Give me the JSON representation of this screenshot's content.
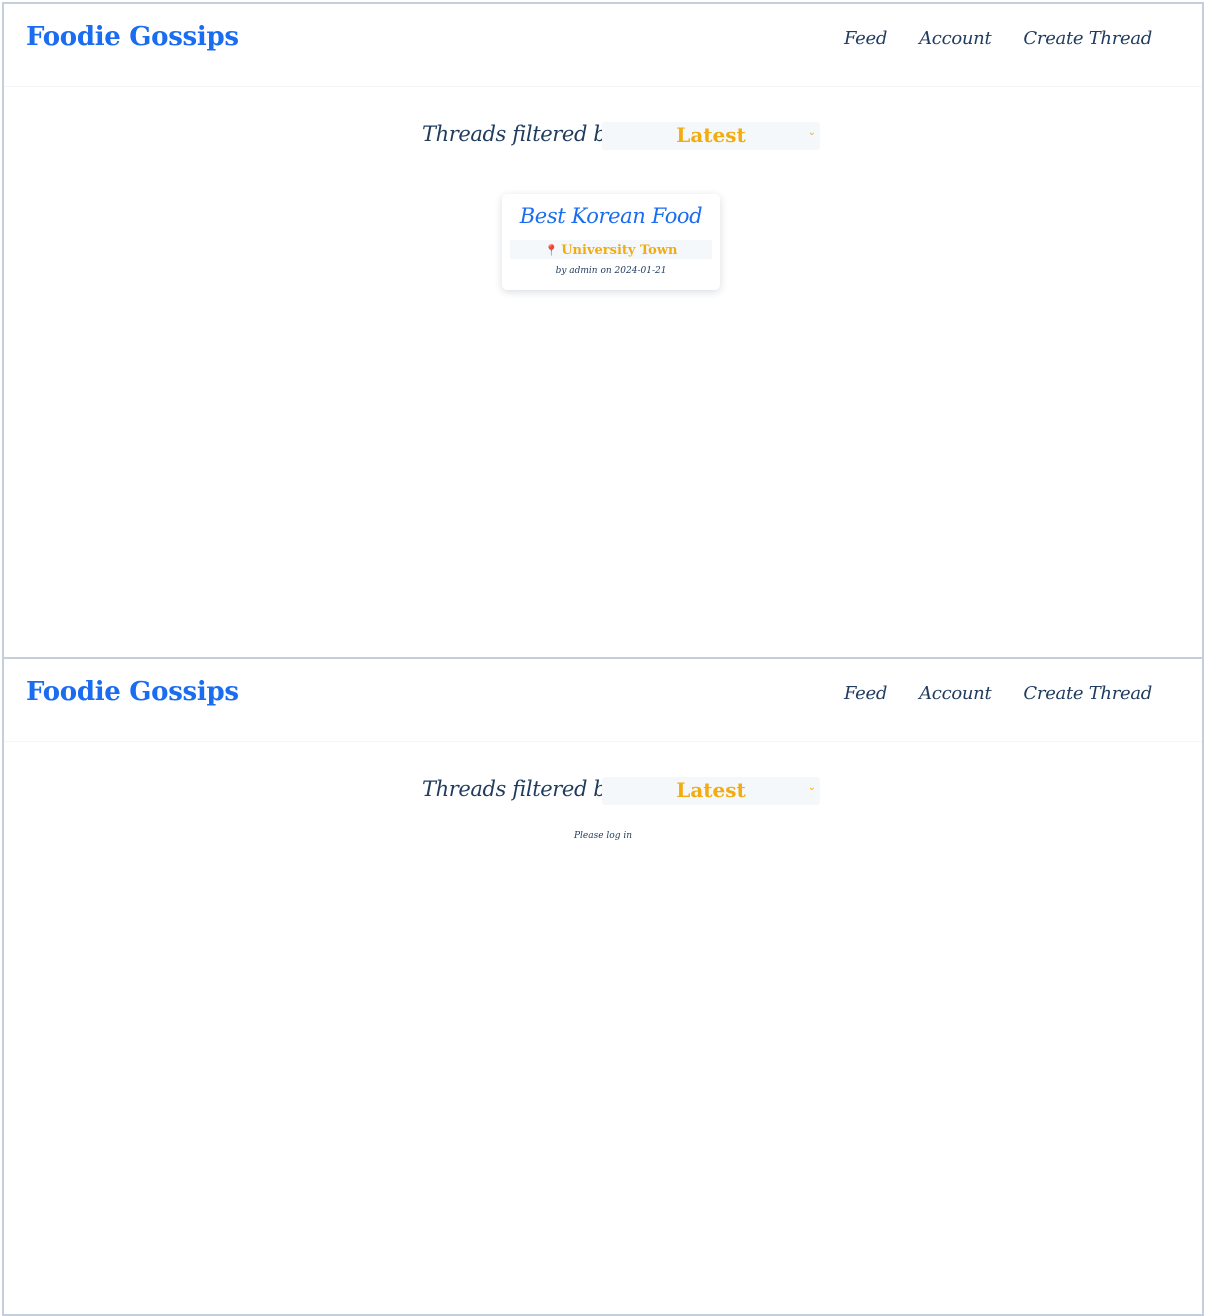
{
  "navbar": {
    "brand": "Foodie Gossips",
    "links": [
      "Feed",
      "Account",
      "Create Thread"
    ]
  },
  "filter": {
    "label": "Threads filtered by",
    "selected": "Latest"
  },
  "threads": [
    {
      "title": "Best Korean Food",
      "location": "University Town",
      "meta": "by admin on 2024-01-21"
    }
  ],
  "logged_out": {
    "message": "Please log in"
  },
  "colors": {
    "brand": "#1a6cf0",
    "accent": "#f2ac12",
    "text": "#1f3b5e",
    "pin": "#e0262c"
  },
  "icons": {
    "location": "map-pin-icon",
    "select_arrow": "chevron-down-icon"
  }
}
